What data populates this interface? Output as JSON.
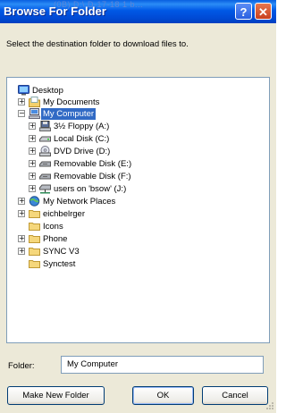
{
  "dialog": {
    "title": "Browse For Folder",
    "background_title_text": "(0B) D:\\  D-17-18 1 b...",
    "help_label": "?",
    "close_label": "✕",
    "instruction": "Select the destination folder to download files to."
  },
  "tree": {
    "items": [
      {
        "label": "Desktop",
        "icon": "desktop-icon",
        "expander": "",
        "selected": false
      },
      {
        "label": "My Documents",
        "icon": "my-documents-icon",
        "expander": "+",
        "selected": false
      },
      {
        "label": "My Computer",
        "icon": "my-computer-icon",
        "expander": "−",
        "selected": true
      },
      {
        "label": "3½ Floppy (A:)",
        "icon": "floppy-drive-icon",
        "expander": "+",
        "selected": false
      },
      {
        "label": "Local Disk (C:)",
        "icon": "local-disk-icon",
        "expander": "+",
        "selected": false
      },
      {
        "label": "DVD Drive (D:)",
        "icon": "dvd-drive-icon",
        "expander": "+",
        "selected": false
      },
      {
        "label": "Removable Disk (E:)",
        "icon": "removable-disk-icon",
        "expander": "+",
        "selected": false
      },
      {
        "label": "Removable Disk (F:)",
        "icon": "removable-disk-icon",
        "expander": "+",
        "selected": false
      },
      {
        "label": "users on 'bsow' (J:)",
        "icon": "network-drive-icon",
        "expander": "+",
        "selected": false
      },
      {
        "label": "My Network Places",
        "icon": "network-places-icon",
        "expander": "+",
        "selected": false
      },
      {
        "label": "eichbelrger",
        "icon": "folder-icon",
        "expander": "+",
        "selected": false
      },
      {
        "label": "Icons",
        "icon": "folder-icon",
        "expander": "",
        "selected": false
      },
      {
        "label": "Phone",
        "icon": "folder-icon",
        "expander": "+",
        "selected": false
      },
      {
        "label": "SYNC V3",
        "icon": "folder-icon",
        "expander": "+",
        "selected": false
      },
      {
        "label": "Synctest",
        "icon": "folder-icon",
        "expander": "",
        "selected": false
      }
    ]
  },
  "folder": {
    "label": "Folder:",
    "value": "My Computer"
  },
  "buttons": {
    "make_new_folder": "Make New Folder",
    "ok": "OK",
    "cancel": "Cancel"
  },
  "colors": {
    "titlebar": "#0054e3",
    "selection": "#316ac5",
    "dialog_background": "#ece9d8"
  }
}
